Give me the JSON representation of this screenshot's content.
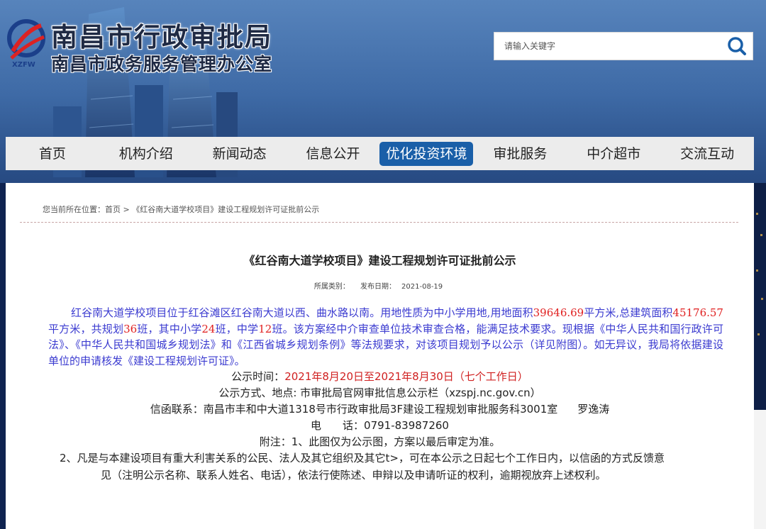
{
  "header": {
    "site_title_main": "南昌市行政审批局",
    "site_title_sub": "南昌市政务服务管理办公室",
    "logo_text": "XZFW"
  },
  "search": {
    "placeholder": "请输入关键字",
    "icon": "search-icon"
  },
  "nav": {
    "items": [
      {
        "label": "首页"
      },
      {
        "label": "机构介绍"
      },
      {
        "label": "新闻动态"
      },
      {
        "label": "信息公开"
      },
      {
        "label": "优化投资环境",
        "active": true
      },
      {
        "label": "审批服务"
      },
      {
        "label": "中介超市"
      },
      {
        "label": "交流互动"
      }
    ]
  },
  "breadcrumb": {
    "prefix": "您当前所在位置：",
    "home": "首页",
    "sep": " > ",
    "current": "《红谷南大道学校项目》建设工程规划许可证批前公示"
  },
  "article": {
    "title": "《红谷南大道学校项目》建设工程规划许可证批前公示",
    "category_label": "所属类别：",
    "date_label": "发布日期：",
    "date": "2021-08-19",
    "para_a": "红谷南大道学校项目位于红谷滩区红谷南大道以西、曲水路以南。用地性质为中小学用地,用地面积",
    "land_area": "39646.69",
    "para_b": "平方米,总建筑面积",
    "building_area": "45176.57",
    "para_c": "平方米，共规划",
    "classes_total": "36",
    "para_d": "班，其中小学",
    "classes_primary": "24",
    "para_e": "班，中学",
    "classes_middle": "12",
    "para_f": "班。该方案经中介审查单位技术审查合格，能满足技术要求。现根据《中华人民共和国行政许可法》、《中华人民共和国城乡规划法》和《江西省城乡规划条例》等法规要求，对该项目规划予以公示（详见附图）。如无异议，我局将依据建设单位的申请核发《建设工程规划许可证》。",
    "period_label": "公示时间：",
    "period_value": "2021年8月20日至2021年8月30日（七个工作日）",
    "method": "公示方式、地点: 市审批局官网审批信息公示栏（xzspj.nc.gov.cn）",
    "contact": "信函联系：南昌市丰和中大道1318号市行政审批局3F建设工程规划审批服务科3001室",
    "contact_person": "罗逸涛",
    "phone_label": "电　　话：",
    "phone": "0791-83987260",
    "note_1": "附注：1、此图仅为公示图，方案以最后审定为准。",
    "note_2_a": "2、凡是与本建设项目有重大利害关系的公民、法人及其它组织及其它t>，可在本公示之日起七个工作日内，以信函的方式反馈意",
    "note_2_b": "见（注明公示名称、联系人姓名、电话），依法行使陈述、申辩以及申请听证的权利，逾期视放弃上述权利。"
  },
  "colors": {
    "nav_active_bg": "#1a5fa8",
    "body_text": "#3b3bd0",
    "highlight_red": "#e02020"
  }
}
